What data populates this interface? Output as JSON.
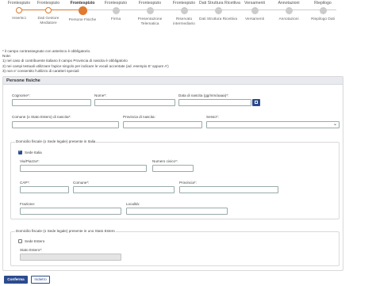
{
  "steps": [
    {
      "top": "Frontespizio",
      "bottom": "Inserisci",
      "state": "done"
    },
    {
      "top": "Frontespizio",
      "bottom": "Dati Gestore Mediatore",
      "state": "done"
    },
    {
      "top": "Frontespizio",
      "bottom": "Persone Fisiche",
      "state": "active"
    },
    {
      "top": "Frontespizio",
      "bottom": "Firma",
      "state": "todo"
    },
    {
      "top": "Frontespizio",
      "bottom": "Presentazione Telematica",
      "state": "todo"
    },
    {
      "top": "Frontespizio",
      "bottom": "Riservato intermediario",
      "state": "todo"
    },
    {
      "top": "Dati Struttura Ricettiva",
      "bottom": "Dati Struttura Ricettiva",
      "state": "todo"
    },
    {
      "top": "Versamenti",
      "bottom": "Versamenti",
      "state": "todo"
    },
    {
      "top": "Annotazioni",
      "bottom": "Annotazioni",
      "state": "todo"
    },
    {
      "top": "Riepilogo",
      "bottom": "Riepilogo Dati",
      "state": "todo"
    }
  ],
  "notes": {
    "line1": "* il campo contrassegnato con asterisco è obbligatorio.",
    "line2": "Note:",
    "line3": "1) nel caso di contribuente italiano il campo Provincia di nascita è obbligatorio",
    "line4": "2) nei campi testuali utilizzare l'apice singolo per indicare le vocali accentate (ad. esempio E' oppure A')",
    "line5": "3) non e' consentito l'utilizzo di caratteri speciali"
  },
  "card": {
    "title": "Persone fisiche",
    "cognome_label": "Cognome*:",
    "nome_label": "Nome*:",
    "data_nascita_label": "Data di nascita (gg/mm/aaaa)*:",
    "comune_label": "Comune (o Stato Estero) di nascita*:",
    "provincia_label": "Provincia di nascita:",
    "sesso_label": "Sesso*:",
    "domicilio_legend": "Domicilio fiscale (o Sede legale) presente in Italia",
    "sede_italia_label": "Sede Italia",
    "via_label": "Via/Piazza*:",
    "civico_label": "Numero civico*:",
    "cap_label": "CAP*:",
    "comune2_label": "Comune*:",
    "provincia2_label": "Provincia*:",
    "frazione_label": "Frazione:",
    "localita_label": "Località:",
    "estero_legend": "Domicilio fiscale (o Sede legale) presente in uno Stato Estero",
    "sede_estero_label": "Sede Estero",
    "stato_estero_label": "Stato Estero*:"
  },
  "buttons": {
    "confirm": "Conferma",
    "back": "Indietro"
  },
  "colors": {
    "accent": "#e07a2e",
    "primary": "#2c4b8f"
  }
}
